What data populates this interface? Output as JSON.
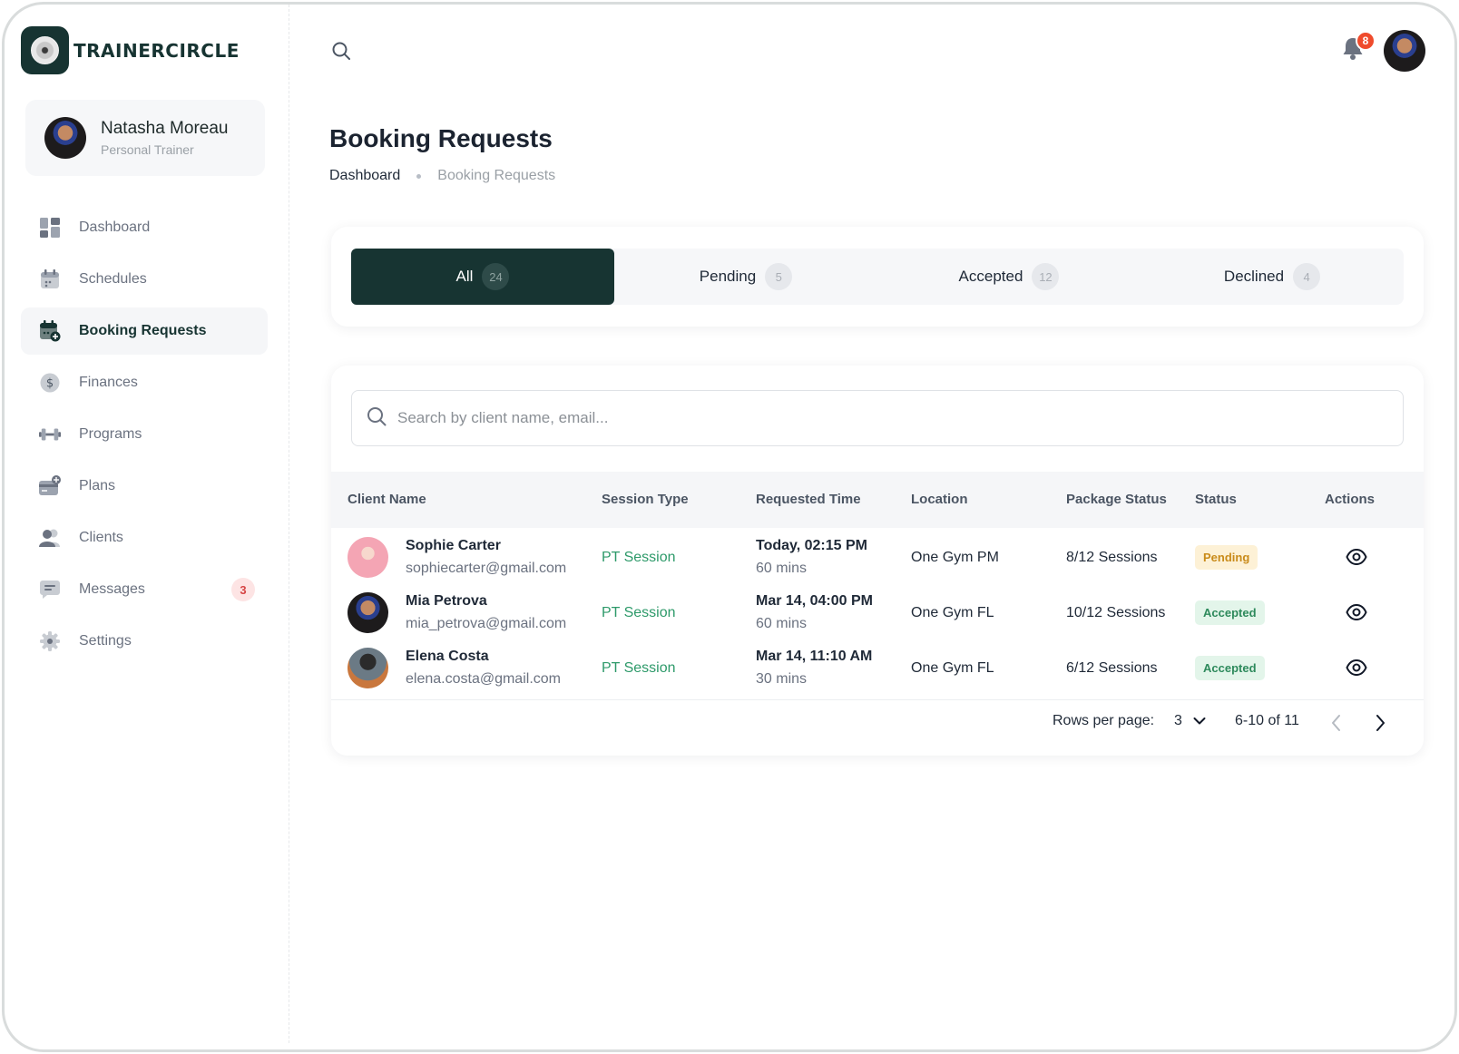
{
  "brand": {
    "name": "TRAINERCIRCLE"
  },
  "profile": {
    "name": "Natasha Moreau",
    "role": "Personal Trainer"
  },
  "sidebar": {
    "items": [
      {
        "label": "Dashboard",
        "icon": "dashboard-icon"
      },
      {
        "label": "Schedules",
        "icon": "calendar-icon"
      },
      {
        "label": "Booking Requests",
        "icon": "calendar-add-icon",
        "active": true
      },
      {
        "label": "Finances",
        "icon": "dollar-icon"
      },
      {
        "label": "Programs",
        "icon": "dumbbell-icon"
      },
      {
        "label": "Plans",
        "icon": "card-add-icon"
      },
      {
        "label": "Clients",
        "icon": "users-icon"
      },
      {
        "label": "Messages",
        "icon": "message-icon",
        "badge": "3"
      },
      {
        "label": "Settings",
        "icon": "gear-icon"
      }
    ]
  },
  "topbar": {
    "notifications": "8"
  },
  "page": {
    "title": "Booking Requests",
    "breadcrumb": {
      "home": "Dashboard",
      "current": "Booking Requests"
    }
  },
  "tabs": [
    {
      "label": "All",
      "count": "24",
      "active": true
    },
    {
      "label": "Pending",
      "count": "5"
    },
    {
      "label": "Accepted",
      "count": "12"
    },
    {
      "label": "Declined",
      "count": "4"
    }
  ],
  "search": {
    "placeholder": "Search by client name, email..."
  },
  "table": {
    "headers": {
      "client": "Client Name",
      "session": "Session Type",
      "time": "Requested Time",
      "location": "Location",
      "package": "Package Status",
      "status": "Status",
      "actions": "Actions"
    },
    "rows": [
      {
        "name": "Sophie Carter",
        "email": "sophiecarter@gmail.com",
        "session": "PT Session",
        "time": "Today, 02:15 PM",
        "duration": "60 mins",
        "location": "One Gym PM",
        "package": "8/12 Sessions",
        "status": "Pending"
      },
      {
        "name": "Mia Petrova",
        "email": "mia_petrova@gmail.com",
        "session": "PT Session",
        "time": "Mar 14, 04:00 PM",
        "duration": "60 mins",
        "location": "One Gym FL",
        "package": "10/12 Sessions",
        "status": "Accepted"
      },
      {
        "name": "Elena Costa",
        "email": "elena.costa@gmail.com",
        "session": "PT Session",
        "time": "Mar 14, 11:10 AM",
        "duration": "30 mins",
        "location": "One Gym FL",
        "package": "6/12 Sessions",
        "status": "Accepted"
      }
    ]
  },
  "pagination": {
    "rows_label": "Rows per page:",
    "rows_value": "3",
    "range": "6-10 of 11"
  },
  "colors": {
    "brand": "#173432",
    "accent_green": "#2e9a6a",
    "pending": "#c98b1a",
    "badge_red": "#ef4b2c"
  }
}
